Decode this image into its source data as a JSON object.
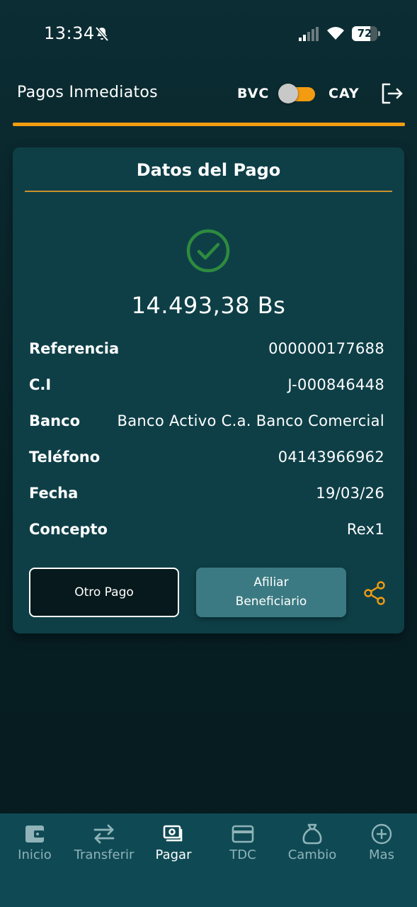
{
  "status_bar": {
    "time": "13:34",
    "battery": "72",
    "battery_level": 0.72
  },
  "header": {
    "title": "Pagos Inmediatos",
    "toggle_left": "BVC",
    "toggle_right": "CAY",
    "accent_color": "#f39c12"
  },
  "card": {
    "title": "Datos del Pago",
    "amount": "14.493,38 Bs",
    "status_icon": "check-circle-icon",
    "details": [
      {
        "label": "Referencia",
        "value": "000000177688"
      },
      {
        "label": "C.I",
        "value": "J-000846448"
      },
      {
        "label": "Banco",
        "value": "Banco Activo C.a. Banco Comercial"
      },
      {
        "label": "Teléfono",
        "value": "04143966962"
      },
      {
        "label": "Fecha",
        "value": "19/03/26"
      },
      {
        "label": "Concepto",
        "value": "Rex1"
      }
    ],
    "buttons": {
      "otro_pago": "Otro Pago",
      "afiliar_line1": "Afiliar",
      "afiliar_line2": "Beneficiario"
    }
  },
  "bottom_nav": [
    {
      "label": "Inicio",
      "icon": "wallet-icon",
      "active": false
    },
    {
      "label": "Transferir",
      "icon": "transfer-arrows-icon",
      "active": false
    },
    {
      "label": "Pagar",
      "icon": "pay-icon",
      "active": true
    },
    {
      "label": "TDC",
      "icon": "credit-card-icon",
      "active": false
    },
    {
      "label": "Cambio",
      "icon": "money-bag-icon",
      "active": false
    },
    {
      "label": "Mas",
      "icon": "plus-circle-icon",
      "active": false
    }
  ]
}
